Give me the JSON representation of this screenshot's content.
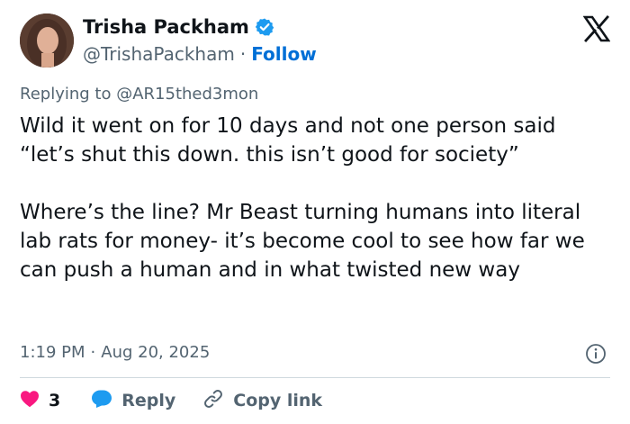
{
  "author": {
    "display_name": "Trisha Packham",
    "handle": "@TrishaPackham",
    "separator": "·",
    "follow_label": "Follow"
  },
  "reply": {
    "prefix": "Replying to",
    "handle": "@AR15thed3mon"
  },
  "tweet": {
    "paragraph1": "Wild it went on for 10 days and not one person said “let’s shut this down. this isn’t good for society”",
    "paragraph2": "Where’s the line? Mr Beast turning humans into literal lab rats for money- it’s become cool to see how far we can push a human and in what twisted new way"
  },
  "meta": {
    "time": "1:19 PM",
    "separator": "·",
    "date": "Aug 20, 2025"
  },
  "actions": {
    "like_count": "3",
    "reply_label": "Reply",
    "copy_label": "Copy link"
  },
  "colors": {
    "like": "#f91880",
    "reply": "#1d9bf0",
    "verified": "#1d9bf0",
    "follow": "#006fd6"
  },
  "icons": [
    "verified-badge-icon",
    "x-logo-icon",
    "info-icon",
    "heart-icon",
    "reply-bubble-icon",
    "link-icon"
  ]
}
